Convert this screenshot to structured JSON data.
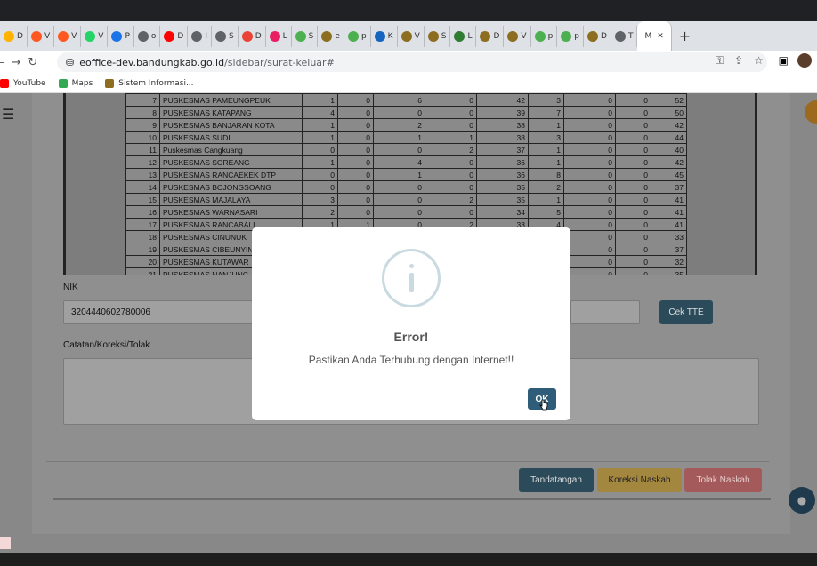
{
  "browser": {
    "tabs": [
      {
        "label": "D",
        "color": "#ffb300"
      },
      {
        "label": "V",
        "color": "#ff5722"
      },
      {
        "label": "V",
        "color": "#ff5722"
      },
      {
        "label": "V",
        "color": "#25d366"
      },
      {
        "label": "P",
        "color": "#1a73e8"
      },
      {
        "label": "o",
        "color": "#5f6368"
      },
      {
        "label": "D",
        "color": "#ff0000"
      },
      {
        "label": "I",
        "color": "#5f6368"
      },
      {
        "label": "S",
        "color": "#5f6368"
      },
      {
        "label": "D",
        "color": "#ea4335"
      },
      {
        "label": "L",
        "color": "#e91e63"
      },
      {
        "label": "S",
        "color": "#4caf50"
      },
      {
        "label": "e",
        "color": "#8d6e20"
      },
      {
        "label": "p",
        "color": "#4caf50"
      },
      {
        "label": "K",
        "color": "#1565c0"
      },
      {
        "label": "V",
        "color": "#8d6e20"
      },
      {
        "label": "S",
        "color": "#8d6e20"
      },
      {
        "label": "L",
        "color": "#2e7d32"
      },
      {
        "label": "D",
        "color": "#8d6e20"
      },
      {
        "label": "V",
        "color": "#8d6e20"
      },
      {
        "label": "p",
        "color": "#4caf50"
      },
      {
        "label": "p",
        "color": "#4caf50"
      },
      {
        "label": "D",
        "color": "#8d6e20"
      },
      {
        "label": "T",
        "color": "#5f6368"
      }
    ],
    "active_tab_label": "M",
    "new_tab": "+",
    "url_host": "eoffice-dev.bandungkab.go.id",
    "url_path": "/sidebar/surat-keluar#",
    "bookmarks": [
      {
        "label": "YouTube",
        "color": "#ff0000"
      },
      {
        "label": "Maps",
        "color": "#34a853"
      },
      {
        "label": "Sistem Informasi...",
        "color": "#8d6e20"
      }
    ]
  },
  "table": {
    "rows": [
      {
        "no": "7",
        "name": "PUSKESMAS PAMEUNGPEUK",
        "c1": "1",
        "c2": "0",
        "c3": "6",
        "c4": "0",
        "c5": "42",
        "c6": "3",
        "c7": "0",
        "c8": "0",
        "total": "52"
      },
      {
        "no": "8",
        "name": "PUSKESMAS KATAPANG",
        "c1": "4",
        "c2": "0",
        "c3": "0",
        "c4": "0",
        "c5": "39",
        "c6": "7",
        "c7": "0",
        "c8": "0",
        "total": "50"
      },
      {
        "no": "9",
        "name": "PUSKESMAS BANJARAN KOTA",
        "c1": "1",
        "c2": "0",
        "c3": "2",
        "c4": "0",
        "c5": "38",
        "c6": "1",
        "c7": "0",
        "c8": "0",
        "total": "42"
      },
      {
        "no": "10",
        "name": "PUSKESMAS SUDI",
        "c1": "1",
        "c2": "0",
        "c3": "1",
        "c4": "1",
        "c5": "38",
        "c6": "3",
        "c7": "0",
        "c8": "0",
        "total": "44"
      },
      {
        "no": "11",
        "name": "Puskesmas Cangkuang",
        "c1": "0",
        "c2": "0",
        "c3": "0",
        "c4": "2",
        "c5": "37",
        "c6": "1",
        "c7": "0",
        "c8": "0",
        "total": "40"
      },
      {
        "no": "12",
        "name": "PUSKESMAS SOREANG",
        "c1": "1",
        "c2": "0",
        "c3": "4",
        "c4": "0",
        "c5": "36",
        "c6": "1",
        "c7": "0",
        "c8": "0",
        "total": "42"
      },
      {
        "no": "13",
        "name": "PUSKESMAS RANCAEKEK DTP",
        "c1": "0",
        "c2": "0",
        "c3": "1",
        "c4": "0",
        "c5": "36",
        "c6": "8",
        "c7": "0",
        "c8": "0",
        "total": "45"
      },
      {
        "no": "14",
        "name": "PUSKESMAS BOJONGSOANG",
        "c1": "0",
        "c2": "0",
        "c3": "0",
        "c4": "0",
        "c5": "35",
        "c6": "2",
        "c7": "0",
        "c8": "0",
        "total": "37"
      },
      {
        "no": "15",
        "name": "PUSKESMAS MAJALAYA",
        "c1": "3",
        "c2": "0",
        "c3": "0",
        "c4": "2",
        "c5": "35",
        "c6": "1",
        "c7": "0",
        "c8": "0",
        "total": "41"
      },
      {
        "no": "16",
        "name": "PUSKESMAS WARNASARI",
        "c1": "2",
        "c2": "0",
        "c3": "0",
        "c4": "0",
        "c5": "34",
        "c6": "5",
        "c7": "0",
        "c8": "0",
        "total": "41"
      },
      {
        "no": "17",
        "name": "PUSKESMAS RANCABALI",
        "c1": "1",
        "c2": "1",
        "c3": "0",
        "c4": "2",
        "c5": "33",
        "c6": "4",
        "c7": "0",
        "c8": "0",
        "total": "41"
      },
      {
        "no": "18",
        "name": "PUSKESMAS CINUNUK",
        "c1": "",
        "c2": "",
        "c3": "",
        "c4": "",
        "c5": "",
        "c6": "",
        "c7": "0",
        "c8": "0",
        "total": "33"
      },
      {
        "no": "19",
        "name": "PUSKESMAS CIBEUNYIN",
        "c1": "",
        "c2": "",
        "c3": "",
        "c4": "",
        "c5": "",
        "c6": "",
        "c7": "0",
        "c8": "0",
        "total": "37"
      },
      {
        "no": "20",
        "name": "PUSKESMAS KUTAWAR",
        "c1": "",
        "c2": "",
        "c3": "",
        "c4": "",
        "c5": "",
        "c6": "",
        "c7": "0",
        "c8": "0",
        "total": "32"
      },
      {
        "no": "21",
        "name": "PUSKESMAS NANJUNG",
        "c1": "",
        "c2": "",
        "c3": "",
        "c4": "",
        "c5": "",
        "c6": "",
        "c7": "0",
        "c8": "0",
        "total": "35"
      }
    ]
  },
  "form": {
    "nik_label": "NIK",
    "nik_value": "3204440602780006",
    "cek_tte_label": "Cek TTE",
    "catatan_label": "Catatan/Koreksi/Tolak",
    "catatan_value": ""
  },
  "actions": {
    "tandatangan": "Tandatangan",
    "koreksi": "Koreksi Naskah",
    "tolak": "Tolak Naskah"
  },
  "modal": {
    "title": "Error!",
    "message": "Pastikan Anda Terhubung dengan Internet!!",
    "ok_label": "OK",
    "icon_glyph": "i"
  },
  "colors": {
    "tandatangan_bg": "#2b4a5a",
    "koreksi_bg": "#a3873f",
    "tolak_bg": "#a45a5a",
    "cek_tte_bg": "#2b4a5a",
    "ok_bg": "#2f5d79"
  }
}
